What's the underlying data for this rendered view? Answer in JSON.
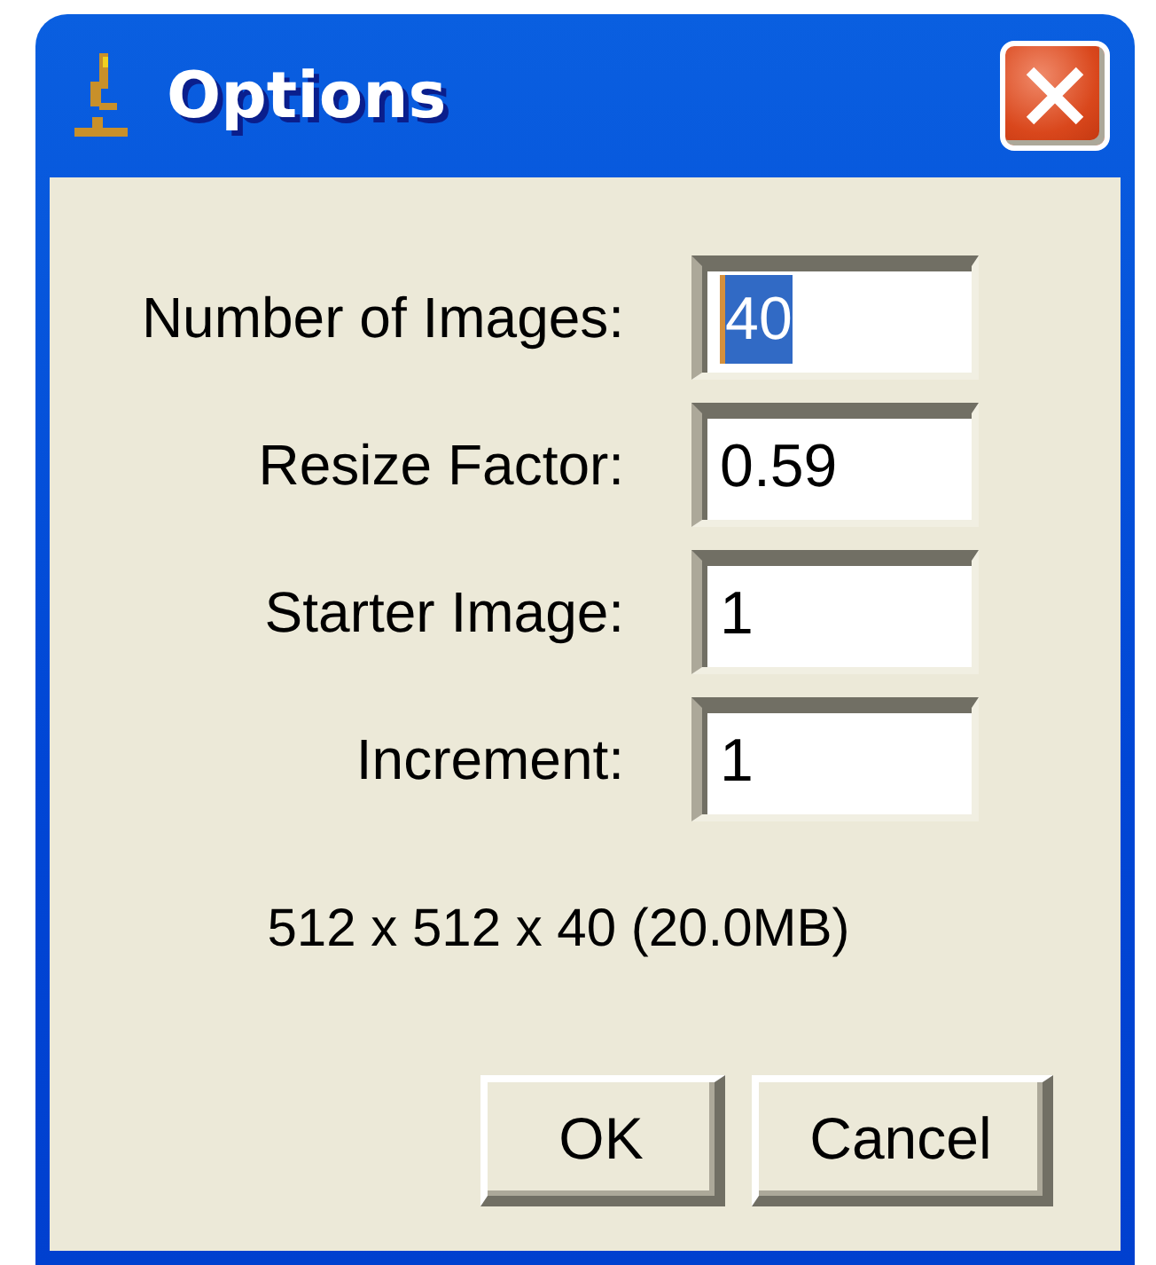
{
  "window": {
    "title": "Options"
  },
  "fields": [
    {
      "label": "Number of Images:",
      "value": "40",
      "text_selected": true
    },
    {
      "label": "Resize Factor:",
      "value": "0.59",
      "text_selected": false
    },
    {
      "label": "Starter Image:",
      "value": "1",
      "text_selected": false
    },
    {
      "label": "Increment:",
      "value": "1",
      "text_selected": false
    }
  ],
  "info": "512 x 512 x 40 (20.0MB)",
  "buttons": [
    "OK",
    "Cancel"
  ]
}
